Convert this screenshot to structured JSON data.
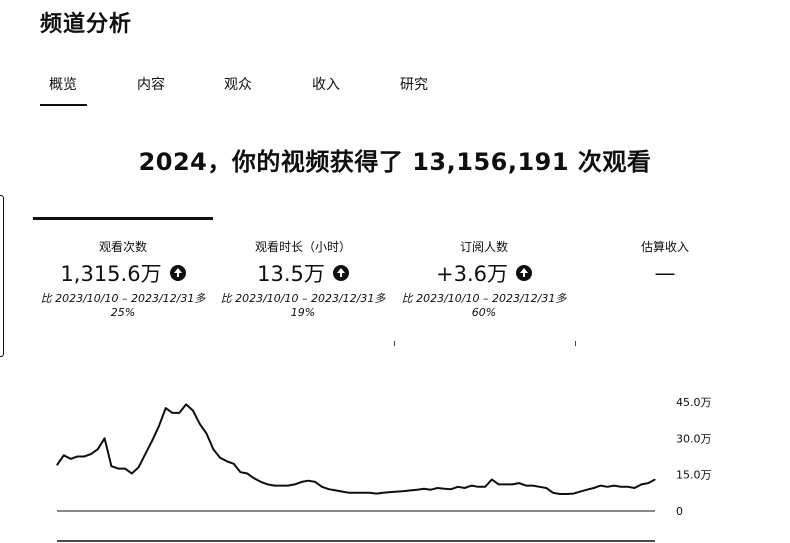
{
  "page": {
    "title": "频道分析"
  },
  "tabs": [
    {
      "label": "概览",
      "selected": true
    },
    {
      "label": "内容",
      "selected": false
    },
    {
      "label": "观众",
      "selected": false
    },
    {
      "label": "收入",
      "selected": false
    },
    {
      "label": "研究",
      "selected": false
    }
  ],
  "headline": "2024，你的视频获得了 13,156,191 次观看",
  "metrics": [
    {
      "label": "观看次数",
      "value": "1,315.6万",
      "trend": "up",
      "compare_line1": "比 2023/10/10 – 2023/12/31多",
      "compare_line2": "25%"
    },
    {
      "label": "观看时长（小时）",
      "value": "13.5万",
      "trend": "up",
      "compare_line1": "比 2023/10/10 – 2023/12/31多",
      "compare_line2": "19%"
    },
    {
      "label": "订阅人数",
      "value": "+3.6万",
      "trend": "up",
      "compare_line1": "比 2023/10/10 – 2023/12/31多",
      "compare_line2": "60%"
    },
    {
      "label": "估算收入",
      "value": "—",
      "trend": "none",
      "compare_line1": "",
      "compare_line2": ""
    }
  ],
  "colors": {
    "text": "#0f0f0f",
    "background": "#ffffff",
    "line": "#0f0f0f"
  },
  "icons": {
    "trend_up": "arrow-up-circle-icon"
  },
  "chart_data": {
    "type": "line",
    "ylim": [
      0,
      450000
    ],
    "y_tick_labels": [
      "0",
      "15.0万",
      "30.0万",
      "45.0万"
    ],
    "y_tick_values": [
      0,
      150000,
      300000,
      450000
    ],
    "grid": false,
    "series": [
      {
        "values": [
          190000,
          230000,
          215000,
          225000,
          225000,
          235000,
          255000,
          300000,
          185000,
          175000,
          175000,
          155000,
          180000,
          235000,
          290000,
          350000,
          425000,
          405000,
          405000,
          440000,
          415000,
          360000,
          320000,
          255000,
          220000,
          205000,
          195000,
          160000,
          155000,
          135000,
          120000,
          110000,
          105000,
          105000,
          105000,
          110000,
          120000,
          125000,
          120000,
          100000,
          90000,
          85000,
          80000,
          75000,
          75000,
          75000,
          75000,
          72000,
          75000,
          78000,
          80000,
          82000,
          85000,
          88000,
          92000,
          88000,
          95000,
          92000,
          90000,
          100000,
          95000,
          105000,
          100000,
          100000,
          130000,
          110000,
          110000,
          110000,
          115000,
          105000,
          105000,
          100000,
          95000,
          75000,
          70000,
          70000,
          72000,
          80000,
          88000,
          95000,
          105000,
          100000,
          105000,
          100000,
          100000,
          95000,
          110000,
          115000,
          130000
        ]
      }
    ]
  }
}
